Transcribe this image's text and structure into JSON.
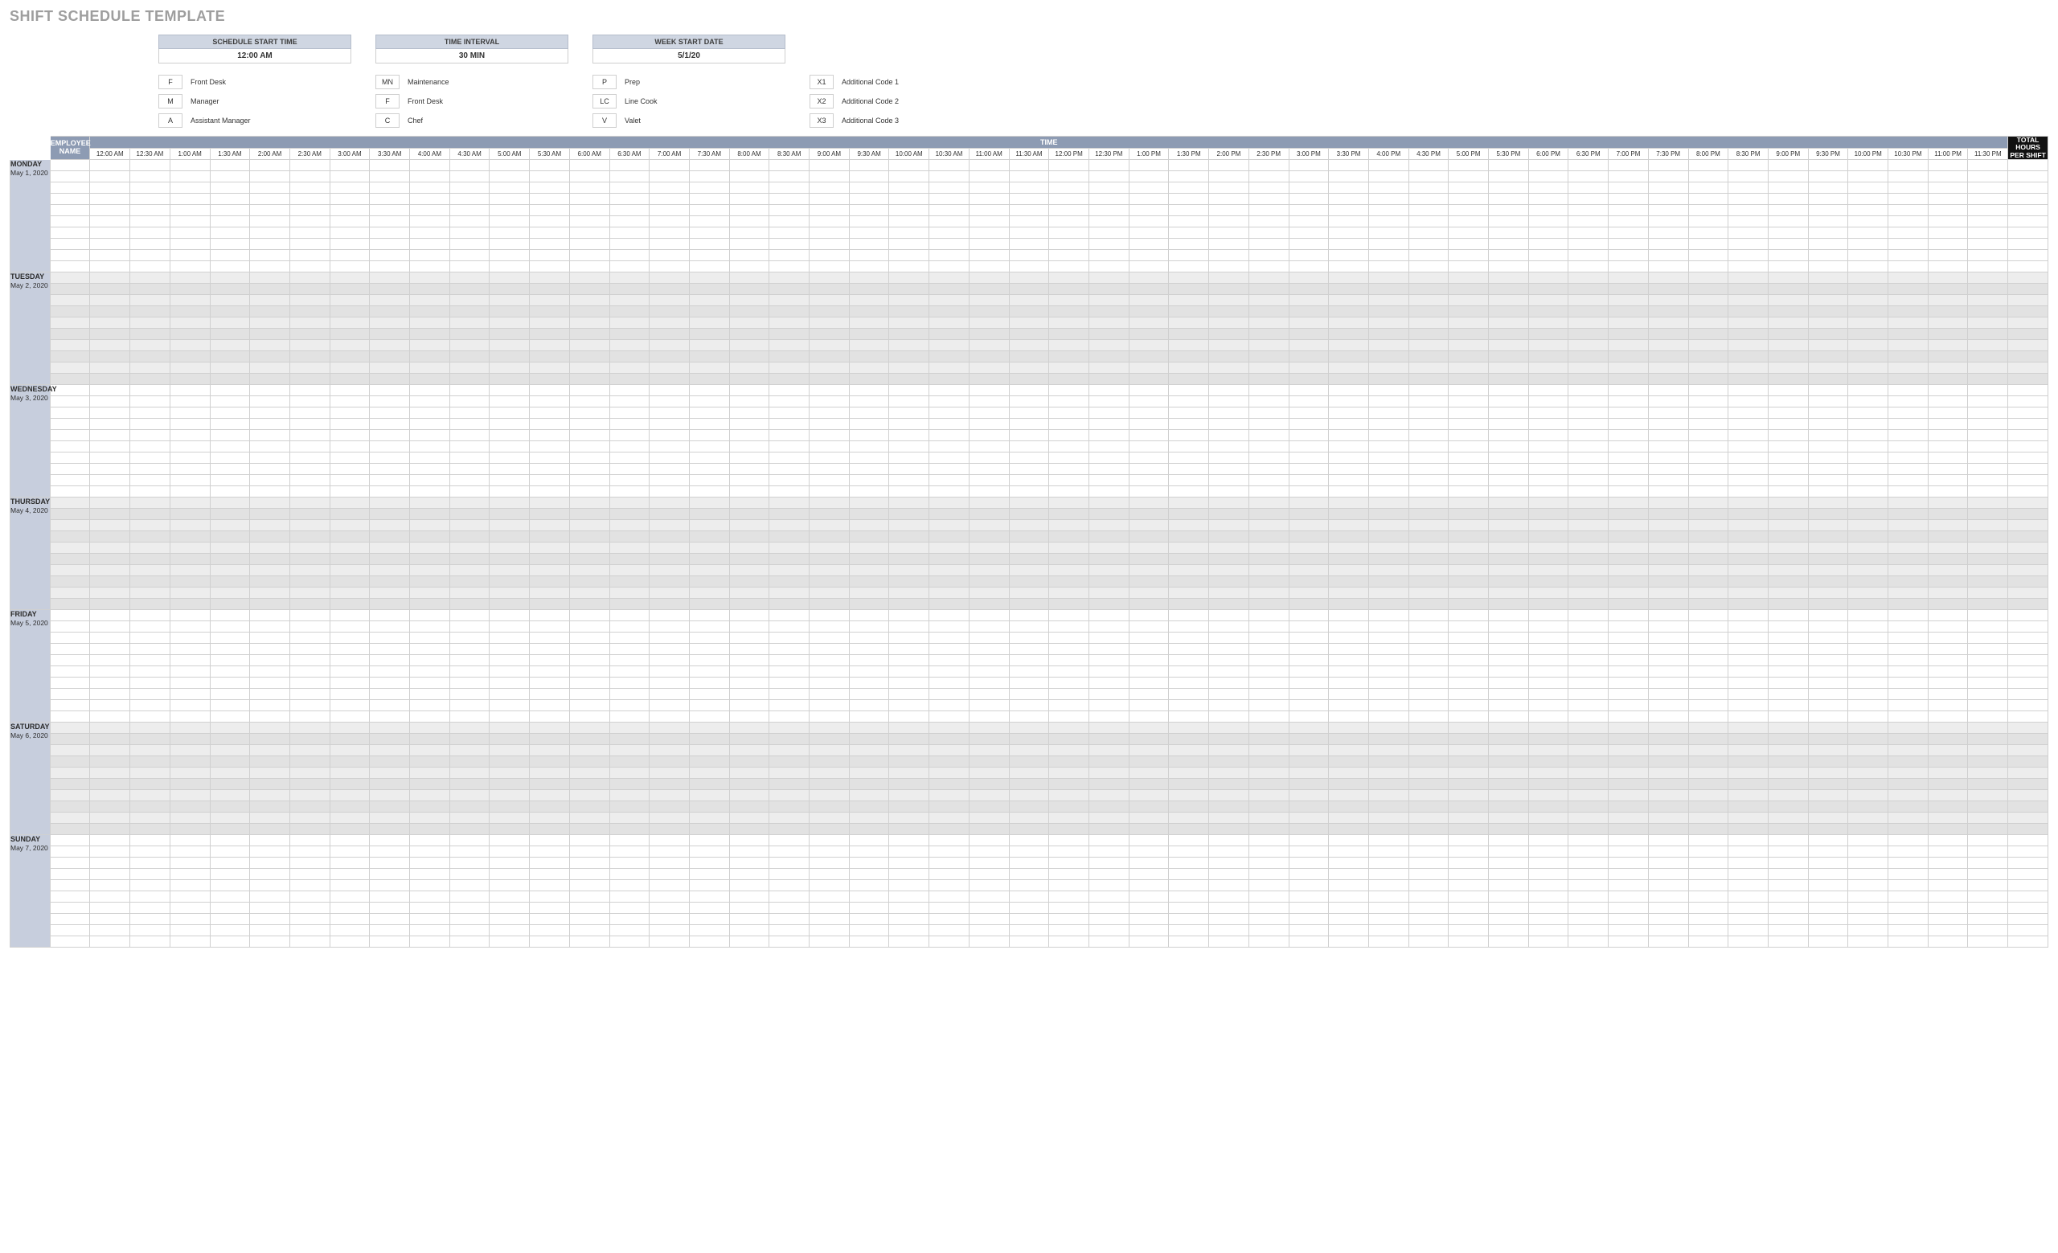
{
  "title": "SHIFT SCHEDULE TEMPLATE",
  "config": {
    "start_time_label": "SCHEDULE START TIME",
    "start_time_value": "12:00 AM",
    "interval_label": "TIME INTERVAL",
    "interval_value": "30 MIN",
    "week_start_label": "WEEK START DATE",
    "week_start_value": "5/1/20"
  },
  "legend": {
    "col1": [
      {
        "code": "F",
        "label": "Front Desk"
      },
      {
        "code": "M",
        "label": "Manager"
      },
      {
        "code": "A",
        "label": "Assistant Manager"
      }
    ],
    "col2": [
      {
        "code": "MN",
        "label": "Maintenance"
      },
      {
        "code": "F",
        "label": "Front Desk"
      },
      {
        "code": "C",
        "label": "Chef"
      }
    ],
    "col3": [
      {
        "code": "P",
        "label": "Prep"
      },
      {
        "code": "LC",
        "label": "Line Cook"
      },
      {
        "code": "V",
        "label": "Valet"
      }
    ],
    "col4": [
      {
        "code": "X1",
        "label": "Additional Code 1"
      },
      {
        "code": "X2",
        "label": "Additional Code 2"
      },
      {
        "code": "X3",
        "label": "Additional Code 3"
      }
    ]
  },
  "headers": {
    "employee": "EMPLOYEE NAME",
    "time_band": "TIME",
    "total": "TOTAL HOURS PER SHIFT"
  },
  "time_slots": [
    "12:00 AM",
    "12:30 AM",
    "1:00 AM",
    "1:30 AM",
    "2:00 AM",
    "2:30 AM",
    "3:00 AM",
    "3:30 AM",
    "4:00 AM",
    "4:30 AM",
    "5:00 AM",
    "5:30 AM",
    "6:00 AM",
    "6:30 AM",
    "7:00 AM",
    "7:30 AM",
    "8:00 AM",
    "8:30 AM",
    "9:00 AM",
    "9:30 AM",
    "10:00 AM",
    "10:30 AM",
    "11:00 AM",
    "11:30 AM",
    "12:00 PM",
    "12:30 PM",
    "1:00 PM",
    "1:30 PM",
    "2:00 PM",
    "2:30 PM",
    "3:00 PM",
    "3:30 PM",
    "4:00 PM",
    "4:30 PM",
    "5:00 PM",
    "5:30 PM",
    "6:00 PM",
    "6:30 PM",
    "7:00 PM",
    "7:30 PM",
    "8:00 PM",
    "8:30 PM",
    "9:00 PM",
    "9:30 PM",
    "10:00 PM",
    "10:30 PM",
    "11:00 PM",
    "11:30 PM"
  ],
  "days": [
    {
      "name": "MONDAY",
      "date": "May 1, 2020",
      "shaded": false,
      "rows": 10
    },
    {
      "name": "TUESDAY",
      "date": "May 2, 2020",
      "shaded": true,
      "rows": 10
    },
    {
      "name": "WEDNESDAY",
      "date": "May 3, 2020",
      "shaded": false,
      "rows": 10
    },
    {
      "name": "THURSDAY",
      "date": "May 4, 2020",
      "shaded": true,
      "rows": 10
    },
    {
      "name": "FRIDAY",
      "date": "May 5, 2020",
      "shaded": false,
      "rows": 10
    },
    {
      "name": "SATURDAY",
      "date": "May 6, 2020",
      "shaded": true,
      "rows": 10
    },
    {
      "name": "SUNDAY",
      "date": "May 7, 2020",
      "shaded": false,
      "rows": 10
    }
  ]
}
